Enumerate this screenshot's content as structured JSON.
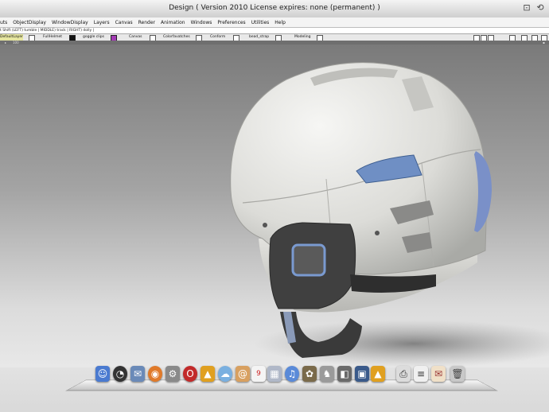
{
  "window": {
    "title": "Design ( Version 2010  License expires: none (permanent) )"
  },
  "menu": [
    "uts",
    "ObjectDisplay",
    "WindowDisplay",
    "Layers",
    "Canvas",
    "Render",
    "Animation",
    "Windows",
    "Preferences",
    "Utilities",
    "Help"
  ],
  "hint": "t Shift  (LEFT) tumble |  MIDDLE) track |  RIGHT) dolly |",
  "shelves": {
    "default_layer": "DefaultLayer",
    "full_helmet": "FullHelmet",
    "goggle_clips": "goggle clips",
    "canvas": "Canvas",
    "color_swatches": "Colorfavatches",
    "conform": "Conform",
    "bead_straps": "bead_strap",
    "modeling": "Modeling"
  },
  "toolstrip_text": "100",
  "colors": {
    "viewport_top": "#7a7a7a",
    "viewport_bottom": "#e8e8e8",
    "helmet_shell": "#e8e8e4",
    "helmet_accent": "#6f8fc4",
    "swatch_black": "#111111",
    "swatch_purple": "#a33bb4"
  },
  "dock": {
    "icons": [
      "finder-icon",
      "dashboard-icon",
      "mail-icon",
      "firefox-icon",
      "system-prefs-icon",
      "opera-icon",
      "illustrator-icon",
      "ichat-icon",
      "address-book-icon",
      "ical-icon",
      "preview-icon",
      "itunes-icon",
      "iphoto-icon",
      "chess-icon",
      "dashboard-widget-icon",
      "photoshop-icon",
      "printer-icon",
      "textedit-icon",
      "mail-stamp-icon",
      "trash-icon"
    ],
    "ical_date": "9"
  }
}
